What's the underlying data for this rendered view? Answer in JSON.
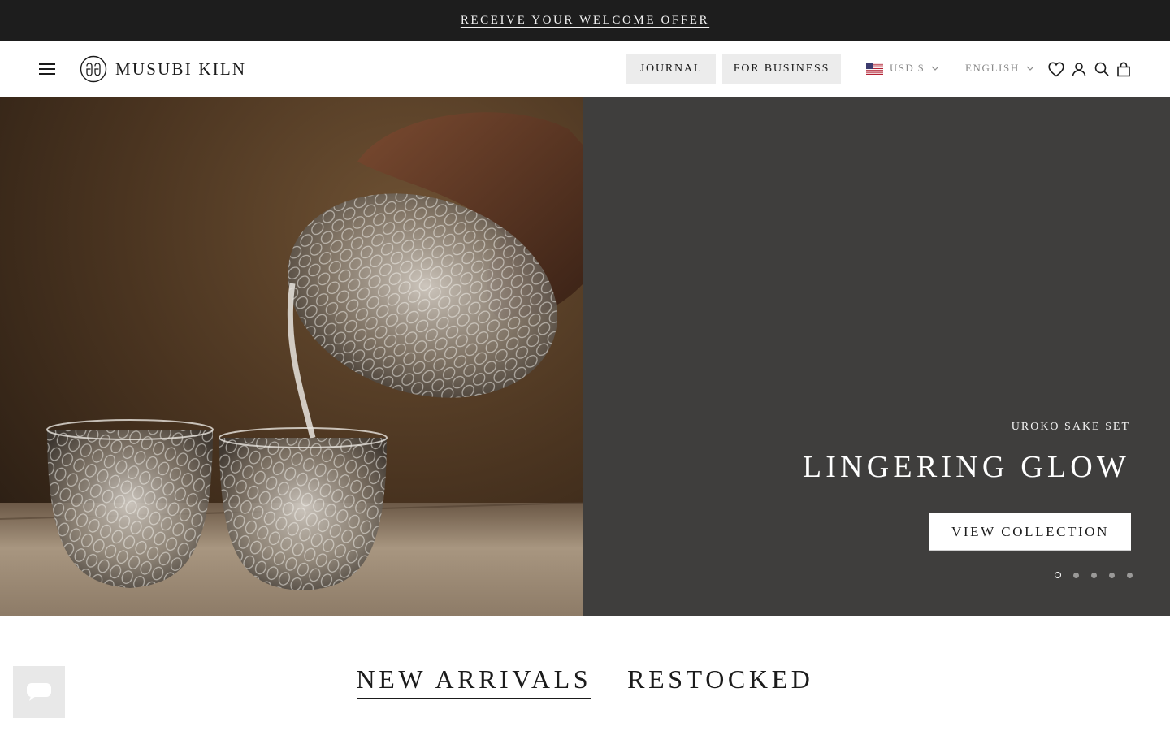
{
  "announcement": {
    "text": "RECEIVE YOUR WELCOME OFFER"
  },
  "header": {
    "logo_text": "MUSUBI KILN",
    "logo_mark": "knot-logo",
    "nav": [
      {
        "label": "JOURNAL"
      },
      {
        "label": "FOR BUSINESS"
      }
    ],
    "currency": {
      "label": "USD $",
      "flag": "us-flag-icon"
    },
    "language": {
      "label": "ENGLISH"
    },
    "icons": [
      "menu-icon",
      "heart-icon",
      "account-icon",
      "search-icon",
      "bag-icon",
      "chevron-down-icon"
    ]
  },
  "hero": {
    "eyebrow": "UROKO SAKE SET",
    "title": "LINGERING GLOW",
    "cta": "VIEW COLLECTION",
    "slides_total": 5,
    "active_slide": 1,
    "panel_color": "#3f3e3d"
  },
  "sections": {
    "tabs": [
      {
        "label": "NEW ARRIVALS",
        "active": true
      },
      {
        "label": "RESTOCKED",
        "active": false
      }
    ]
  },
  "chat": {
    "icon": "chat-bubble-icon"
  },
  "colors": {
    "announcement_bg": "#1d1d1d",
    "nav_button_bg": "#ececec",
    "muted_text": "#8a8a8a"
  }
}
